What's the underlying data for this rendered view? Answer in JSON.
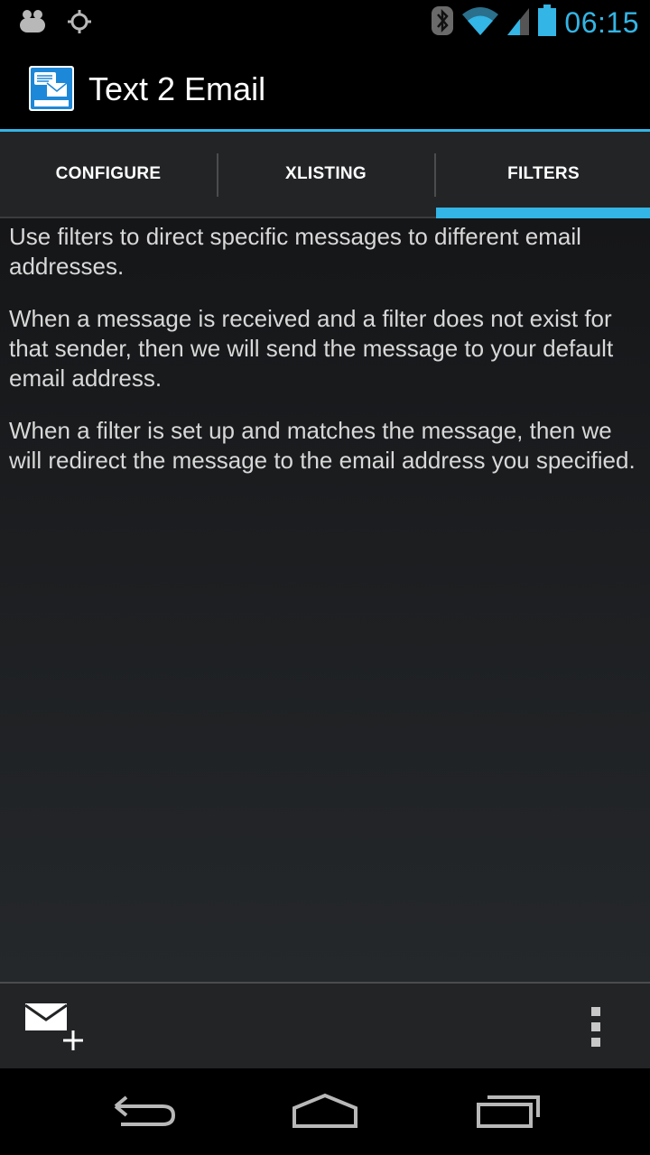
{
  "status_bar": {
    "time": "06:15",
    "icons": [
      "notification-icon",
      "gps-icon",
      "bluetooth-icon",
      "wifi-icon",
      "signal-icon",
      "battery-icon"
    ],
    "clock_color": "#33b5e5"
  },
  "app": {
    "title": "Text 2 Email",
    "icon": "text2email-app-icon"
  },
  "tabs": [
    {
      "label": "CONFIGURE",
      "selected": false
    },
    {
      "label": "XLISTING",
      "selected": false
    },
    {
      "label": "FILTERS",
      "selected": true
    }
  ],
  "content": {
    "paragraphs": [
      "Use filters to direct specific messages to different email addresses.",
      "When a message is received and a filter does not exist for that sender, then we will send the message to your default email address.",
      "When a filter is set up and matches the message, then we will redirect the message to the email address you specified."
    ]
  },
  "bottom_bar": {
    "actions": [
      "add-email-icon",
      "overflow-menu-icon"
    ]
  },
  "nav_bar": {
    "buttons": [
      "back-icon",
      "home-icon",
      "recents-icon"
    ]
  },
  "colors": {
    "accent": "#33b5e5",
    "tab_bg": "#222426",
    "content_bg": "#1c1e20"
  }
}
